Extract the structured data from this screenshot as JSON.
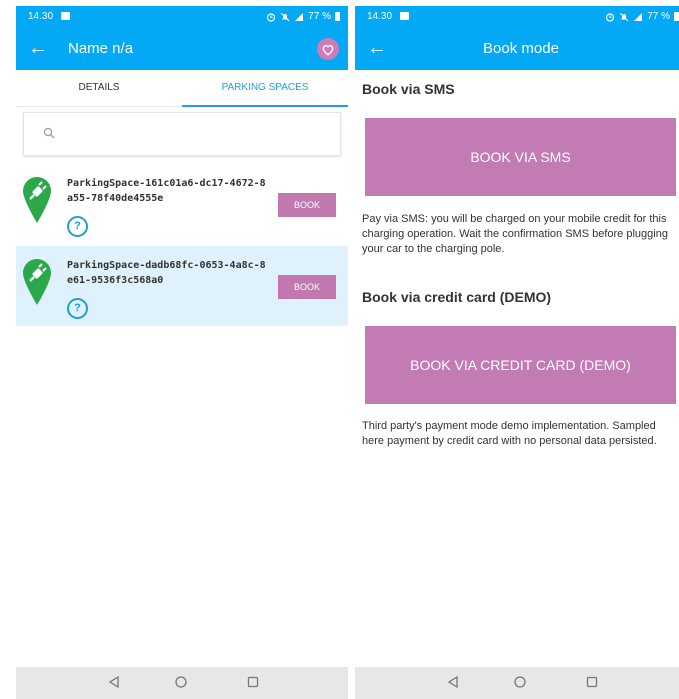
{
  "status": {
    "time": "14.30",
    "battery": "77 %"
  },
  "left": {
    "title": "Name n/a",
    "tabs": [
      {
        "label": "DETAILS"
      },
      {
        "label": "PARKING SPACES"
      }
    ],
    "search": {
      "placeholder": ""
    },
    "items": [
      {
        "name": "ParkingSpace-161c01a6-dc17-4672-8a55-78f40de4555e",
        "help": "?",
        "book": "BOOK"
      },
      {
        "name": "ParkingSpace-dadb68fc-0653-4a8c-8e61-9536f3c568a0",
        "help": "?",
        "book": "BOOK"
      }
    ]
  },
  "right": {
    "title": "Book mode",
    "sms": {
      "heading": "Book via SMS",
      "button": "BOOK VIA SMS",
      "description": "Pay via SMS: you will be charged on your mobile credit for this charging operation. Wait the confirmation SMS before plugging your car to the charging pole."
    },
    "card": {
      "heading": "Book via credit card (DEMO)",
      "button": "BOOK VIA CREDIT CARD (DEMO)",
      "description": "Third party's payment mode demo implementation. Sampled here payment by credit card with no personal data persisted."
    }
  },
  "colors": {
    "appbar": "#03A9F4",
    "accent": "#C27BB3",
    "pin": "#2BA84A",
    "selected": "#DFF1FC",
    "tab_active": "#1FA0DC"
  },
  "icons": [
    "back-arrow-icon",
    "heart-icon",
    "search-icon",
    "ev-plug-pin-icon",
    "help-icon",
    "nav-back-icon",
    "nav-home-icon",
    "nav-recents-icon",
    "alarm-icon",
    "bell-off-icon",
    "signal-icon",
    "battery-icon",
    "message-icon"
  ]
}
